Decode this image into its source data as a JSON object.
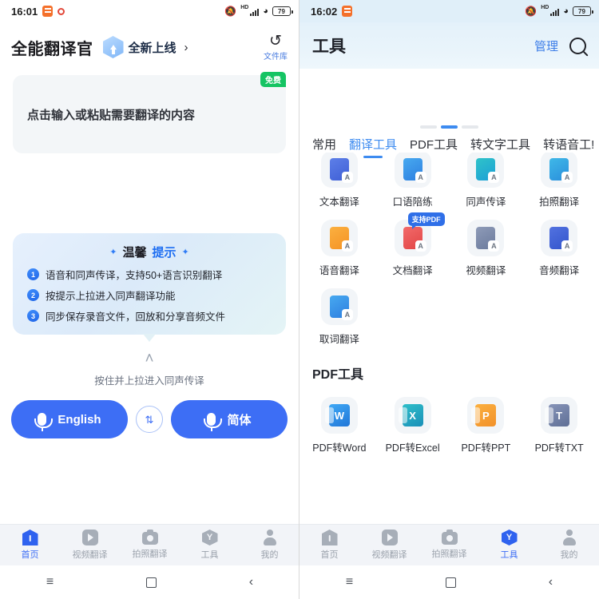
{
  "left": {
    "status": {
      "time": "16:01",
      "battery": "79",
      "hd": "HD",
      "icons": [
        "bell-off-icon",
        "signal-icon",
        "wifi-icon",
        "battery-icon"
      ]
    },
    "header": {
      "app_title": "全能翻译官",
      "promo_label": "全新上线",
      "promo_chevron": "›",
      "filelib_label": "文件库",
      "filelib_icon": "↺"
    },
    "input": {
      "free_badge": "免费",
      "placeholder": "点击输入或粘贴需要翻译的内容"
    },
    "tips": {
      "title_plain": "温馨",
      "title_highlight": "提示",
      "spark": "✦",
      "items": [
        {
          "num": "1",
          "text": "语音和同声传译，支持50+语言识别翻译"
        },
        {
          "num": "2",
          "text": "按提示上拉进入同声翻译功能"
        },
        {
          "num": "3",
          "text": "同步保存录音文件，回放和分享音频文件"
        }
      ]
    },
    "pullup": {
      "chevron": "˄",
      "label": "按住并上拉进入同声传译"
    },
    "mic": {
      "source_label": "English",
      "target_label": "简体",
      "swap_icon": "⇅"
    },
    "tabbar": {
      "items": [
        {
          "label": "首页",
          "icon": "home-icon",
          "active": true
        },
        {
          "label": "视频翻译",
          "icon": "video-icon",
          "active": false
        },
        {
          "label": "拍照翻译",
          "icon": "camera-icon",
          "active": false
        },
        {
          "label": "工具",
          "icon": "tools-icon",
          "active": false
        },
        {
          "label": "我的",
          "icon": "user-icon",
          "active": false
        }
      ]
    },
    "navbar": {
      "menu": "≡",
      "home": "square",
      "back": "‹"
    }
  },
  "right": {
    "status": {
      "time": "16:02",
      "battery": "79",
      "hd": "HD",
      "icons": [
        "bell-off-icon",
        "signal-icon",
        "wifi-icon",
        "battery-icon"
      ]
    },
    "header": {
      "title": "工具",
      "manage_label": "管理",
      "search_icon": "search-icon"
    },
    "pager": {
      "count": 3,
      "active_index": 1
    },
    "tabs": [
      {
        "label": "常用",
        "active": false
      },
      {
        "label": "翻译工具",
        "active": true
      },
      {
        "label": "PDF工具",
        "active": false
      },
      {
        "label": "转文字工具",
        "active": false
      },
      {
        "label": "转语音工!",
        "active": false
      }
    ],
    "translate_tools": [
      {
        "label": "文本翻译",
        "color": "doc-blue",
        "badge": null
      },
      {
        "label": "口语陪练",
        "color": "doc-sky",
        "badge": null
      },
      {
        "label": "同声传译",
        "color": "doc-teal",
        "badge": null
      },
      {
        "label": "拍照翻译",
        "color": "doc-cyan",
        "badge": null
      },
      {
        "label": "语音翻译",
        "color": "doc-orange",
        "badge": null
      },
      {
        "label": "文档翻译",
        "color": "doc-red",
        "badge": "支持PDF"
      },
      {
        "label": "视频翻译",
        "color": "doc-slate",
        "badge": null
      },
      {
        "label": "音频翻译",
        "color": "doc-indigo",
        "badge": null
      },
      {
        "label": "取词翻译",
        "color": "doc-sky",
        "badge": null
      }
    ],
    "pdf_section_title": "PDF工具",
    "pdf_tools": [
      {
        "label": "PDF转Word",
        "letter": "W",
        "color": "of-word"
      },
      {
        "label": "PDF转Excel",
        "letter": "X",
        "color": "of-excel"
      },
      {
        "label": "PDF转PPT",
        "letter": "P",
        "color": "of-ppt"
      },
      {
        "label": "PDF转TXT",
        "letter": "T",
        "color": "of-txt"
      }
    ],
    "tabbar": {
      "items": [
        {
          "label": "首页",
          "icon": "home-icon",
          "active": false
        },
        {
          "label": "视频翻译",
          "icon": "video-icon",
          "active": false
        },
        {
          "label": "拍照翻译",
          "icon": "camera-icon",
          "active": false
        },
        {
          "label": "工具",
          "icon": "tools-icon",
          "active": true
        },
        {
          "label": "我的",
          "icon": "user-icon",
          "active": false
        }
      ]
    },
    "navbar": {
      "menu": "≡",
      "home": "square",
      "back": "‹"
    }
  },
  "colors": {
    "accent_blue": "#3d6ef5",
    "tab_blue": "#3d8bf0",
    "free_green": "#15c463",
    "badge_blue": "#2f6fe8"
  }
}
